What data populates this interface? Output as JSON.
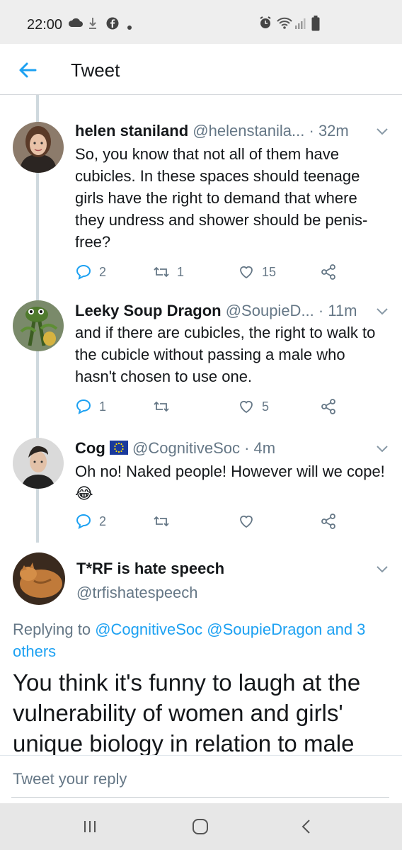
{
  "status_bar": {
    "time": "22:00",
    "left_icons": [
      "cloud-icon",
      "download-icon",
      "facebook-icon",
      "dot-icon"
    ],
    "right_icons": [
      "alarm-icon",
      "wifi-icon",
      "signal-icon",
      "battery-icon"
    ]
  },
  "header": {
    "title": "Tweet",
    "back_icon": "arrow-left-icon"
  },
  "tweets": [
    {
      "name": "helen staniland",
      "handle": "@helenstanila...",
      "time": "· 32m",
      "text": "So, you know that not all of them have cubicles. In these spaces should teenage girls have the right to demand that where they undress and shower should be penis-free?",
      "replies": "2",
      "retweets": "1",
      "likes": "15"
    },
    {
      "name": "Leeky Soup Dragon",
      "handle": "@SoupieD...",
      "time": "· 11m",
      "text": "and if there are cubicles, the right to walk to the cubicle without passing a male who hasn't chosen to use one.",
      "replies": "1",
      "retweets": "",
      "likes": "5"
    },
    {
      "name": "Cog",
      "flag_icon": "eu-flag-icon",
      "handle": "@CognitiveSoc",
      "time": "· 4m",
      "text": "Oh no! Naked people! However will we cope!",
      "emoji": "😂",
      "replies": "2",
      "retweets": "",
      "likes": ""
    }
  ],
  "focused": {
    "name": "T*RF is hate speech",
    "handle": "@trfishatespeech",
    "replying_prefix": "Replying to ",
    "replying_mentions": "@CognitiveSoc @SoupieDragon and 3 others",
    "text": "You think it's funny to laugh at the vulnerability of women and girls' unique biology in relation to male"
  },
  "reply_bar": {
    "placeholder": "Tweet your reply"
  },
  "colors": {
    "accent": "#1da1f2",
    "muted": "#657786",
    "text": "#14171a"
  },
  "nav": {
    "icons": [
      "recents-icon",
      "home-icon",
      "back-icon"
    ]
  }
}
